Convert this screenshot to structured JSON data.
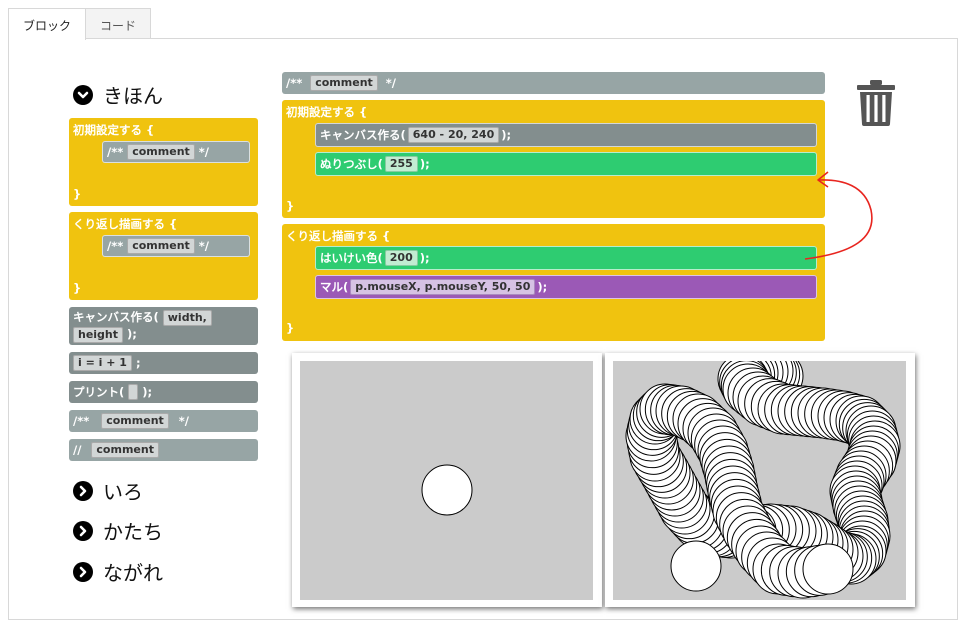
{
  "tabs": [
    "ブロック",
    "コード"
  ],
  "categories": {
    "basic": "きほん",
    "color": "いろ",
    "shape": "かたち",
    "flow": "ながれ"
  },
  "palette": {
    "setup_header": "初期設定する {",
    "loop_header": "くり返し描画する {",
    "close_brace": "}",
    "comment_prefix": "/**",
    "comment_text": "comment",
    "comment_suffix": "*/",
    "createcanvas_label": "キャンバス作る(",
    "createcanvas_arg1": "width,",
    "createcanvas_arg2": "height",
    "createcanvas_close": ");",
    "assign_expr": "i = i + 1",
    "assign_close": ";",
    "print_label": "プリント(",
    "print_close": ");",
    "line_comment_prefix": "//",
    "line_comment_text": "comment"
  },
  "workspace": {
    "top_comment_prefix": "/**",
    "top_comment_text": "comment",
    "top_comment_suffix": "*/",
    "setup_header": "初期設定する {",
    "createcanvas_label": "キャンバス作る(",
    "createcanvas_args": "640 - 20, 240",
    "createcanvas_close": ");",
    "fill_label": "ぬりつぶし(",
    "fill_value": "255",
    "fill_close": ");",
    "close_brace": "}",
    "loop_header": "くり返し描画する {",
    "background_label": "はいけい色(",
    "background_value": "200",
    "background_close": ");",
    "ellipse_label": "マル(",
    "ellipse_args": "p.mouseX, p.mouseY, 50, 50",
    "ellipse_close": ");"
  },
  "colors": {
    "control_yellow": "#f0c30f",
    "block_gray": "#838e8e",
    "comment_gray": "#97a5a5",
    "color_green": "#2ecc71",
    "shape_purple": "#9b59b6",
    "canvas_bg": "#cbcbcb",
    "arrow_red": "#e8251f"
  },
  "icons": {
    "category_expanded": "chevron-down-circle-icon",
    "category_collapsed": "chevron-right-circle-icon",
    "trash": "trash-icon"
  }
}
